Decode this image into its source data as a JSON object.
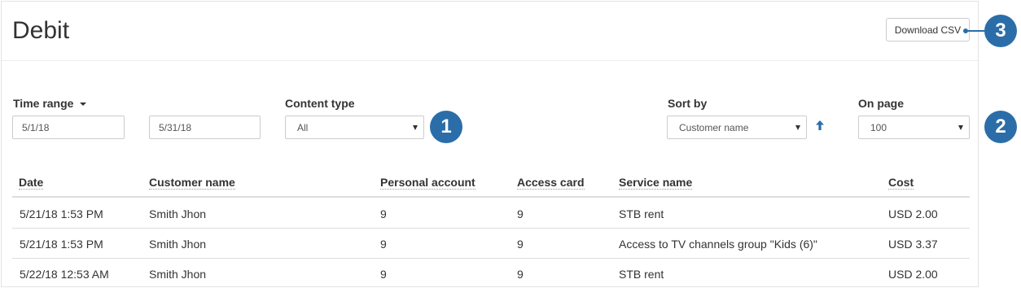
{
  "header": {
    "title": "Debit",
    "download_csv_label": "Download CSV"
  },
  "filters": {
    "time_range": {
      "label": "Time range",
      "from_value": "5/1/18",
      "to_value": "5/31/18"
    },
    "content_type": {
      "label": "Content type",
      "selected": "All"
    },
    "sort_by": {
      "label": "Sort by",
      "selected": "Customer name",
      "direction": "ascending"
    },
    "on_page": {
      "label": "On page",
      "selected": "100"
    }
  },
  "callouts": {
    "one": "1",
    "two": "2",
    "three": "3"
  },
  "table": {
    "columns": [
      "Date",
      "Customer name",
      "Personal account",
      "Access card",
      "Service name",
      "Cost"
    ],
    "rows": [
      [
        "5/21/18 1:53 PM",
        "Smith Jhon",
        "9",
        "9",
        "STB rent",
        "USD 2.00"
      ],
      [
        "5/21/18 1:53 PM",
        "Smith Jhon",
        "9",
        "9",
        "Access to TV channels group \"Kids (6)\"",
        "USD 3.37"
      ],
      [
        "5/22/18 12:53 AM",
        "Smith Jhon",
        "9",
        "9",
        "STB rent",
        "USD 2.00"
      ]
    ]
  },
  "colors": {
    "callout": "#2b6da8",
    "sort_arrow": "#2b6da8",
    "border": "#cccccc"
  },
  "icons": {
    "time_range_caret": "caret-down-icon",
    "select_arrow": "caret-down-icon",
    "sort_direction": "arrow-up-icon"
  }
}
